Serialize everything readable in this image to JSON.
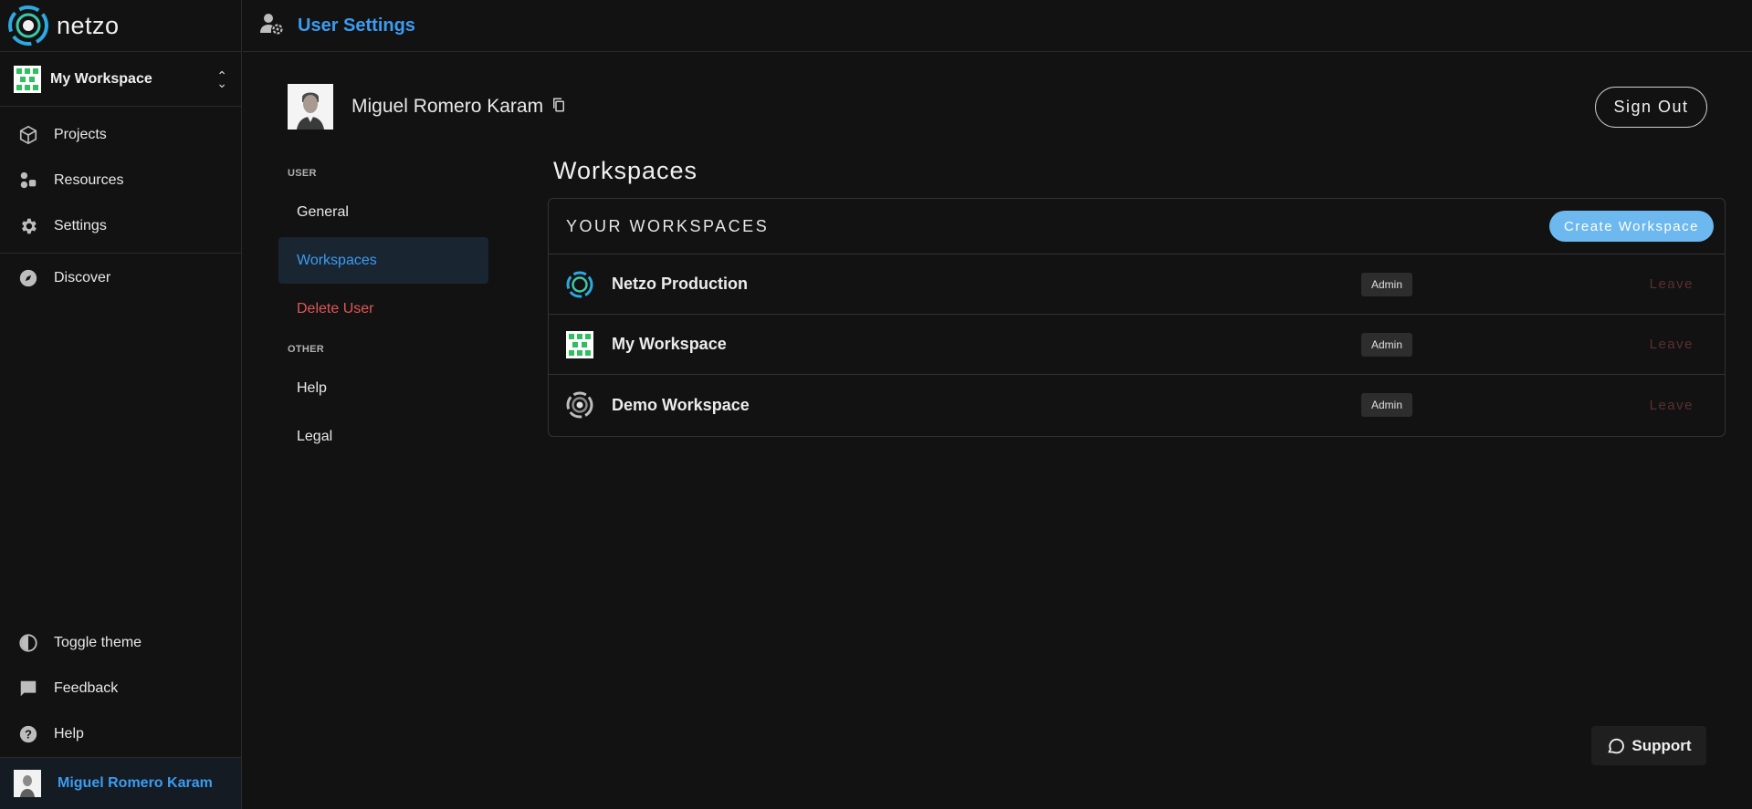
{
  "app": {
    "logo_text": "netzo"
  },
  "sidebar": {
    "workspace": "My Workspace",
    "items": [
      {
        "label": "Projects",
        "icon": "cube-icon"
      },
      {
        "label": "Resources",
        "icon": "shapes-icon"
      },
      {
        "label": "Settings",
        "icon": "gear-icon"
      },
      {
        "label": "Discover",
        "icon": "compass-icon"
      }
    ],
    "bottom_items": [
      {
        "label": "Toggle theme",
        "icon": "contrast-icon"
      },
      {
        "label": "Feedback",
        "icon": "chat-icon"
      },
      {
        "label": "Help",
        "icon": "help-circle-icon"
      }
    ],
    "user_name": "Miguel Romero Karam"
  },
  "header": {
    "title": "User Settings"
  },
  "profile": {
    "name": "Miguel Romero Karam",
    "sign_out": "Sign Out"
  },
  "settings_menu": {
    "user_section": "USER",
    "user_items": [
      "General",
      "Workspaces",
      "Delete User"
    ],
    "other_section": "OTHER",
    "other_items": [
      "Help",
      "Legal"
    ]
  },
  "workspaces": {
    "title": "Workspaces",
    "panel_label": "YOUR WORKSPACES",
    "create_button": "Create Workspace",
    "rows": [
      {
        "name": "Netzo Production",
        "role": "Admin",
        "action": "Leave"
      },
      {
        "name": "My Workspace",
        "role": "Admin",
        "action": "Leave"
      },
      {
        "name": "Demo Workspace",
        "role": "Admin",
        "action": "Leave"
      }
    ]
  },
  "support": {
    "label": "Support"
  },
  "colors": {
    "accent": "#3b9cf0",
    "danger": "#e05757",
    "create_button": "#6cb8ef"
  }
}
